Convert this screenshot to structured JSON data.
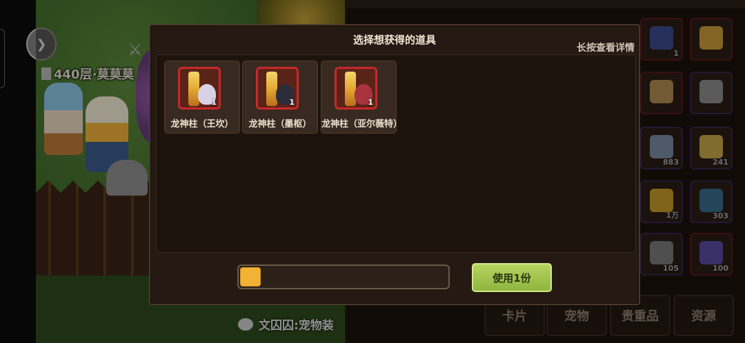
{
  "modal": {
    "title": "选择想获得的道具",
    "hint": "长按查看详情",
    "items": [
      {
        "name": "龙神柱（王坎）",
        "count": "1",
        "icon": "dragon-pillar-icon",
        "head_color": "#d9d2e6"
      },
      {
        "name": "龙神柱（墨枢）",
        "count": "1",
        "icon": "dragon-pillar-icon",
        "head_color": "#2c2c3a"
      },
      {
        "name": "龙神柱（亚尔薇特）",
        "count": "1",
        "icon": "dragon-pillar-icon",
        "head_color": "#a7343e"
      }
    ],
    "quantity_fraction": 0.1,
    "use_button": "使用1份"
  },
  "scene": {
    "floor_label": "440层·莫莫莫",
    "chat_text": "文囚囚:宠物装"
  },
  "inventory": {
    "counts": [
      "1",
      "883",
      "241",
      "1万",
      "303",
      "105",
      "100"
    ],
    "tabs": [
      "卡片",
      "宠物",
      "贵重品",
      "资源"
    ]
  },
  "colors": {
    "accent_green": "#9fc34a",
    "frame_red": "#c8282a",
    "fill_orange": "#f2b233"
  }
}
